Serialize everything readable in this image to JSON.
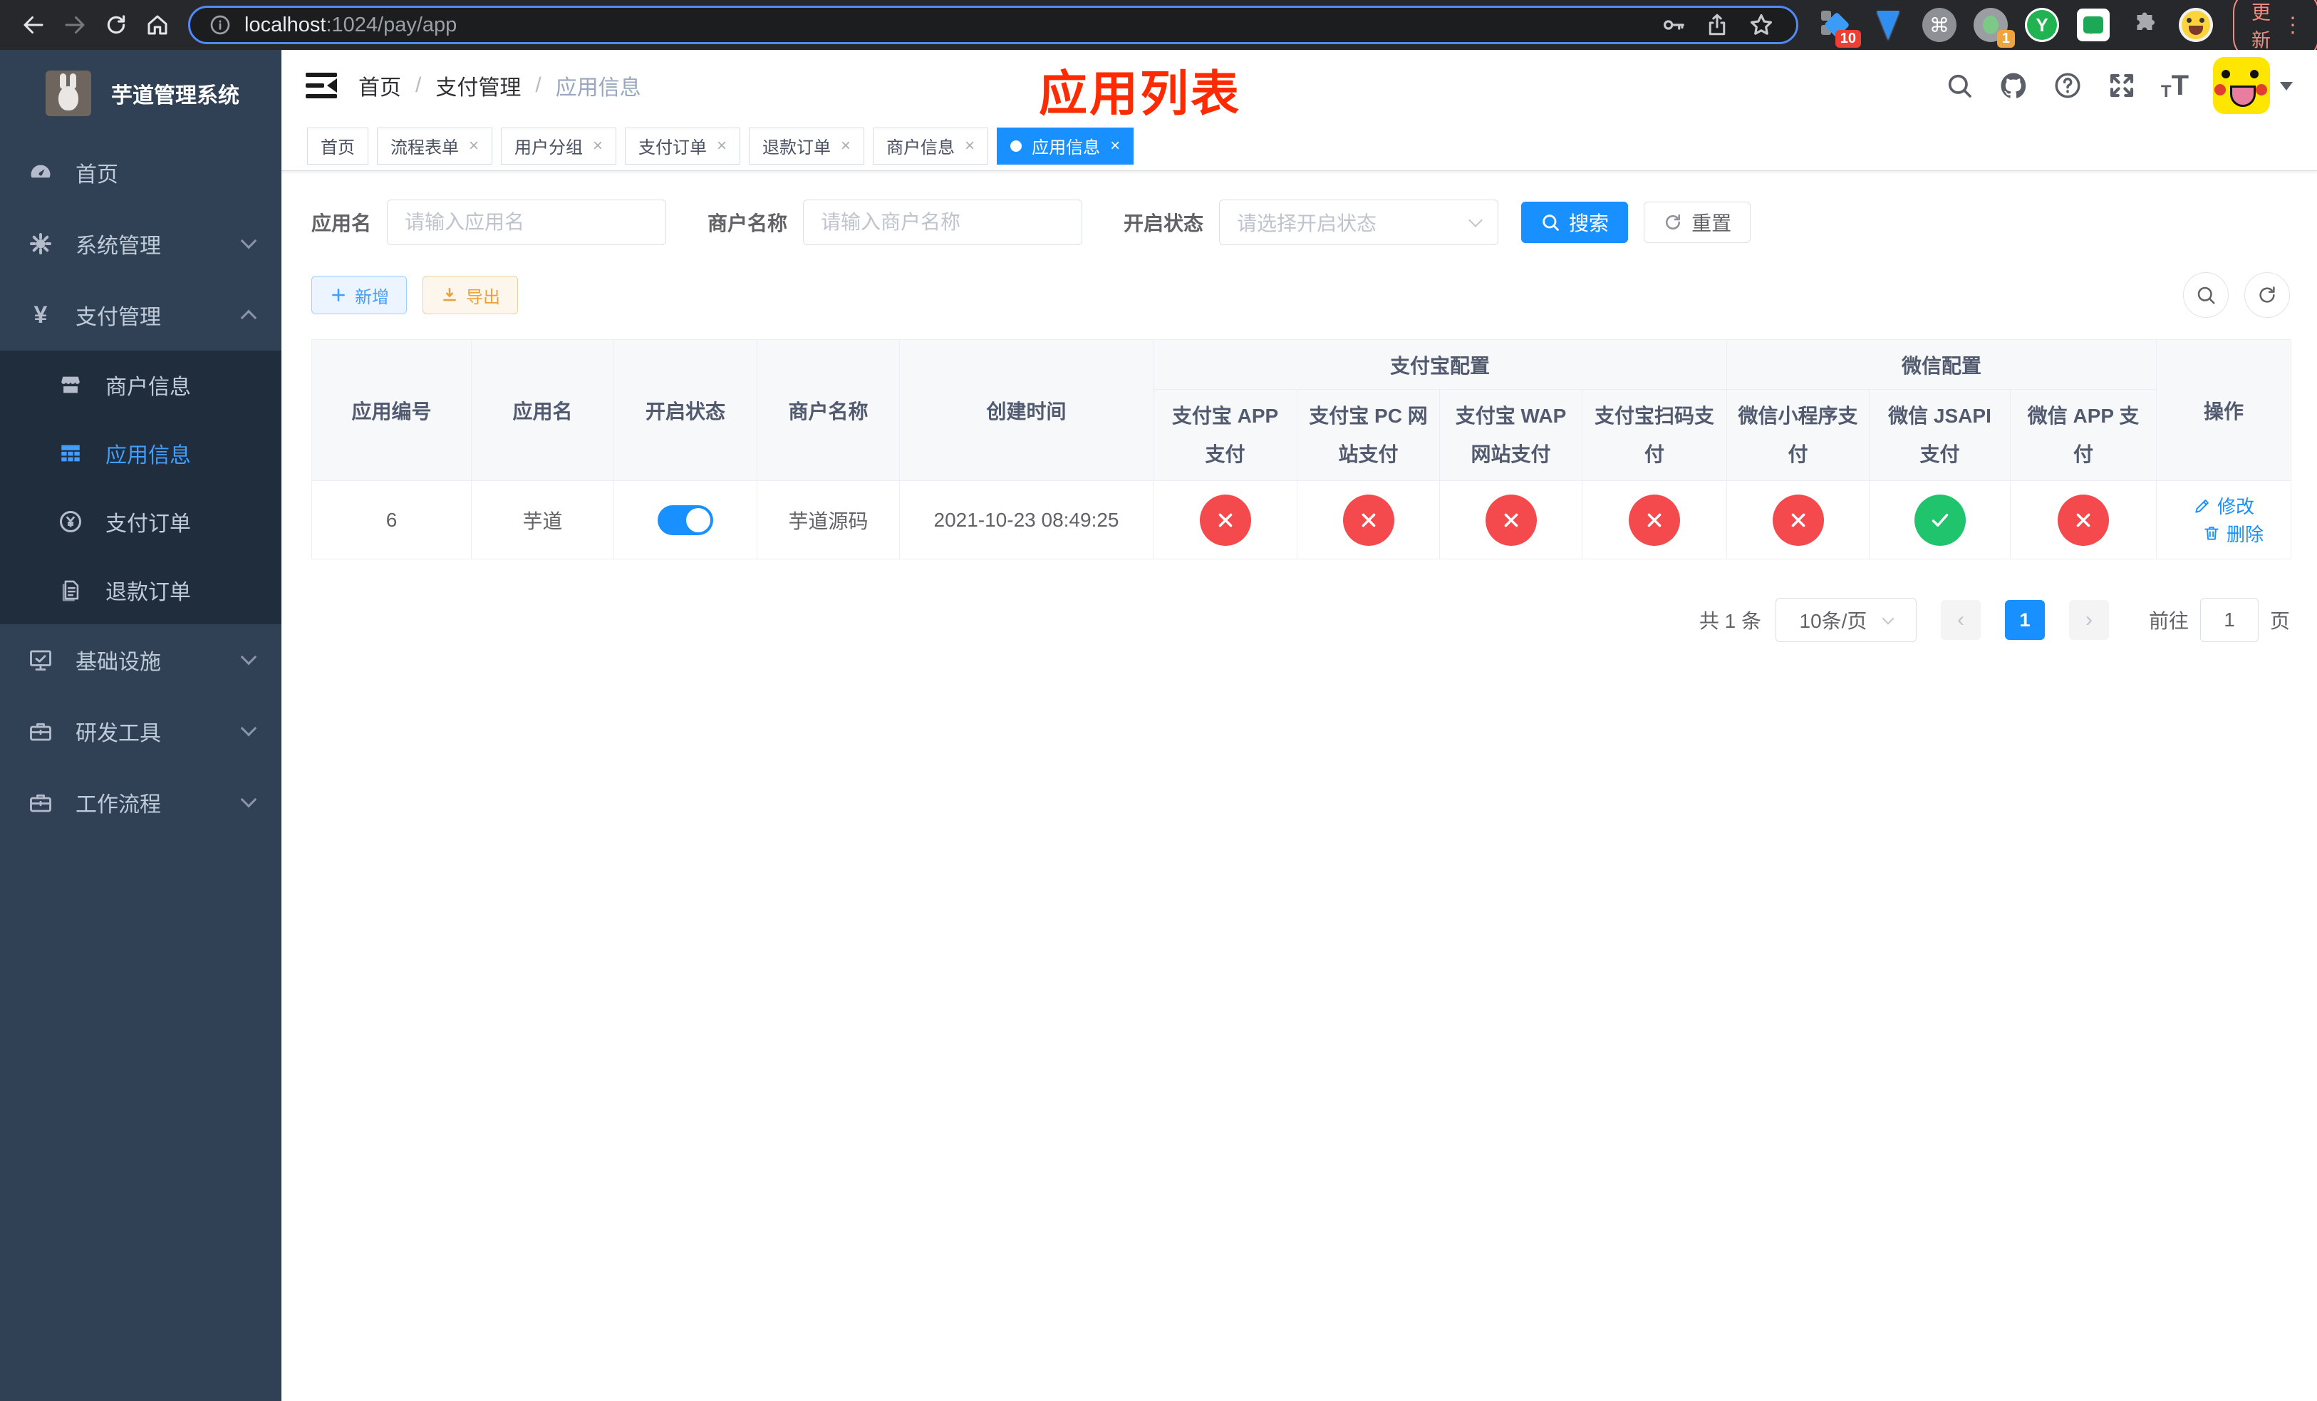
{
  "browser": {
    "url_host": "localhost",
    "url_rest": ":1024/pay/app",
    "update_label": "更新",
    "kebab_glyph": "⋮",
    "ext_badge_count_1": "10",
    "ext_badge_count_2": "1",
    "ext_y_letter": "Y",
    "ext_command_glyph": "⌘"
  },
  "sidebar": {
    "logo_title": "芋道管理系统",
    "items": [
      {
        "label": "首页"
      },
      {
        "label": "系统管理"
      },
      {
        "label": "支付管理"
      },
      {
        "label": "商户信息"
      },
      {
        "label": "应用信息"
      },
      {
        "label": "支付订单"
      },
      {
        "label": "退款订单"
      },
      {
        "label": "基础设施"
      },
      {
        "label": "研发工具"
      },
      {
        "label": "工作流程"
      }
    ],
    "yen_glyph": "¥"
  },
  "header": {
    "breadcrumb": [
      "首页",
      "支付管理",
      "应用信息"
    ],
    "breadcrumb_sep": "/",
    "page_annotation": "应用列表"
  },
  "tabs": [
    {
      "label": "首页"
    },
    {
      "label": "流程表单"
    },
    {
      "label": "用户分组"
    },
    {
      "label": "支付订单"
    },
    {
      "label": "退款订单"
    },
    {
      "label": "商户信息"
    },
    {
      "label": "应用信息"
    }
  ],
  "tab_close_glyph": "×",
  "filters": {
    "app_name_label": "应用名",
    "app_name_placeholder": "请输入应用名",
    "merchant_label": "商户名称",
    "merchant_placeholder": "请输入商户名称",
    "status_label": "开启状态",
    "status_placeholder": "请选择开启状态",
    "search_label": "搜索",
    "reset_label": "重置"
  },
  "toolbar": {
    "add_label": "新增",
    "export_label": "导出"
  },
  "table": {
    "group_headers": {
      "alipay": "支付宝配置",
      "wechat": "微信配置"
    },
    "columns": [
      "应用编号",
      "应用名",
      "开启状态",
      "商户名称",
      "创建时间"
    ],
    "channel_columns": [
      "支付宝 APP 支付",
      "支付宝 PC 网站支付",
      "支付宝 WAP 网站支付",
      "支付宝扫码支付",
      "微信小程序支付",
      "微信 JSAPI 支付",
      "微信 APP 支付"
    ],
    "actions_header": "操作",
    "rows": [
      {
        "id": "6",
        "name": "芋道",
        "enabled": true,
        "merchant": "芋道源码",
        "created": "2021-10-23 08:49:25",
        "channels": [
          false,
          false,
          false,
          false,
          false,
          true,
          false
        ],
        "edit_label": "修改",
        "delete_label": "删除"
      }
    ]
  },
  "pagination": {
    "total": "共 1 条",
    "page_size": "10条/页",
    "prev_glyph": "‹",
    "next_glyph": "›",
    "current_page": "1",
    "goto_prefix": "前往",
    "goto_value": "1",
    "goto_suffix": "页"
  },
  "colors": {
    "primary": "#1890ff",
    "link_blue": "#409eff",
    "success": "#1fc46d",
    "danger": "#f4494d",
    "warning": "#e6a23c",
    "annotation_red": "#ff2a00",
    "sidebar_bg": "#304156",
    "sidebar_submenu_bg": "#1f2d3d",
    "sidebar_text": "#bfcbd9"
  }
}
